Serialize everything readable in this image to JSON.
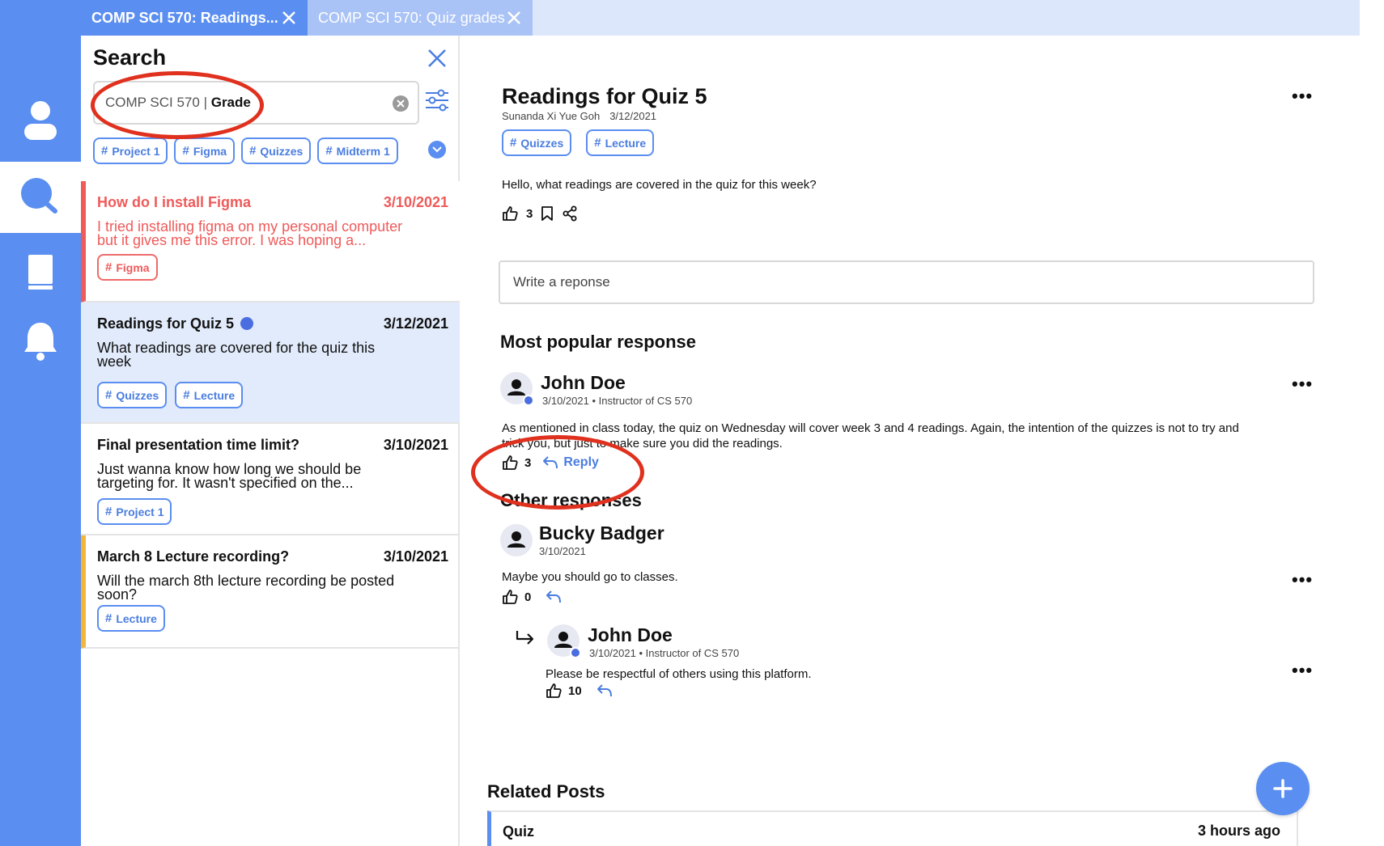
{
  "colors": {
    "accent": "#5a8ef0",
    "tab_inactive": "#a9c3f6",
    "alert_red": "#ef5a5a",
    "highlight_yellow": "#f2b73a",
    "annotation_red": "#e0301e",
    "selected_bg": "#e2ebfb"
  },
  "rail": {
    "items": [
      {
        "icon": "user-icon"
      },
      {
        "icon": "search-icon",
        "active": true
      },
      {
        "icon": "book-icon"
      },
      {
        "icon": "bell-icon"
      }
    ]
  },
  "tabs": [
    {
      "label": "COMP SCI 570: Readings...",
      "active": true
    },
    {
      "label": "COMP SCI 570: Quiz grades",
      "active": false
    }
  ],
  "search": {
    "title": "Search",
    "query_prefix": "COMP SCI 570 |",
    "query_term": "Grade",
    "filter_chips": [
      "Project 1",
      "Figma",
      "Quizzes",
      "Midterm 1"
    ]
  },
  "results": [
    {
      "title": "How do I install Figma",
      "date": "3/10/2021",
      "snippet_line1": "I tried installing figma on my personal computer",
      "snippet_line2": "but it gives me this error. I was hoping a...",
      "tags": [
        "Figma"
      ],
      "style": "red"
    },
    {
      "title": "Readings for Quiz 5",
      "date": "3/12/2021",
      "snippet_line1": "What readings are covered for the quiz this",
      "snippet_line2": "week",
      "tags": [
        "Quizzes",
        "Lecture"
      ],
      "style": "selected",
      "verified": true
    },
    {
      "title": "Final presentation time limit?",
      "date": "3/10/2021",
      "snippet_line1": "Just wanna know how long we should be",
      "snippet_line2": "targeting for. It wasn't specified on the...",
      "tags": [
        "Project 1"
      ],
      "style": "plain"
    },
    {
      "title": "March 8 Lecture recording?",
      "date": "3/10/2021",
      "snippet_line1": "Will the march 8th lecture recording be posted",
      "snippet_line2": "soon?",
      "tags": [
        "Lecture"
      ],
      "style": "yellow"
    }
  ],
  "post": {
    "title": "Readings for Quiz 5",
    "author": "Sunanda Xi Yue Goh",
    "date": "3/12/2021",
    "tags": [
      "Quizzes",
      "Lecture"
    ],
    "body": "Hello, what readings are covered in the quiz for this week?",
    "likes": "3",
    "more": "•••"
  },
  "reply_box": {
    "placeholder": "Write a reponse"
  },
  "popular": {
    "heading": "Most popular response",
    "name": "John Doe",
    "sub": "3/10/2021 • Instructor of CS 570",
    "text_line1": "As mentioned in class today, the quiz on Wednesday will cover week 3 and 4 readings. Again, the intention of the quizzes is not to try and",
    "text_line2": "trick you, but just to make sure you did the readings.",
    "likes": "3",
    "reply_label": "Reply"
  },
  "other": {
    "heading": "Other responses",
    "name": "Bucky Badger",
    "sub": "3/10/2021",
    "text": "Maybe you should go to classes.",
    "likes": "0",
    "nested": {
      "name": "John Doe",
      "sub": "3/10/2021 • Instructor of CS 570",
      "text": "Please be respectful of others using this platform.",
      "likes": "10"
    }
  },
  "related": {
    "heading": "Related Posts",
    "items": [
      {
        "title": "Quiz",
        "time": "3 hours ago"
      }
    ]
  }
}
